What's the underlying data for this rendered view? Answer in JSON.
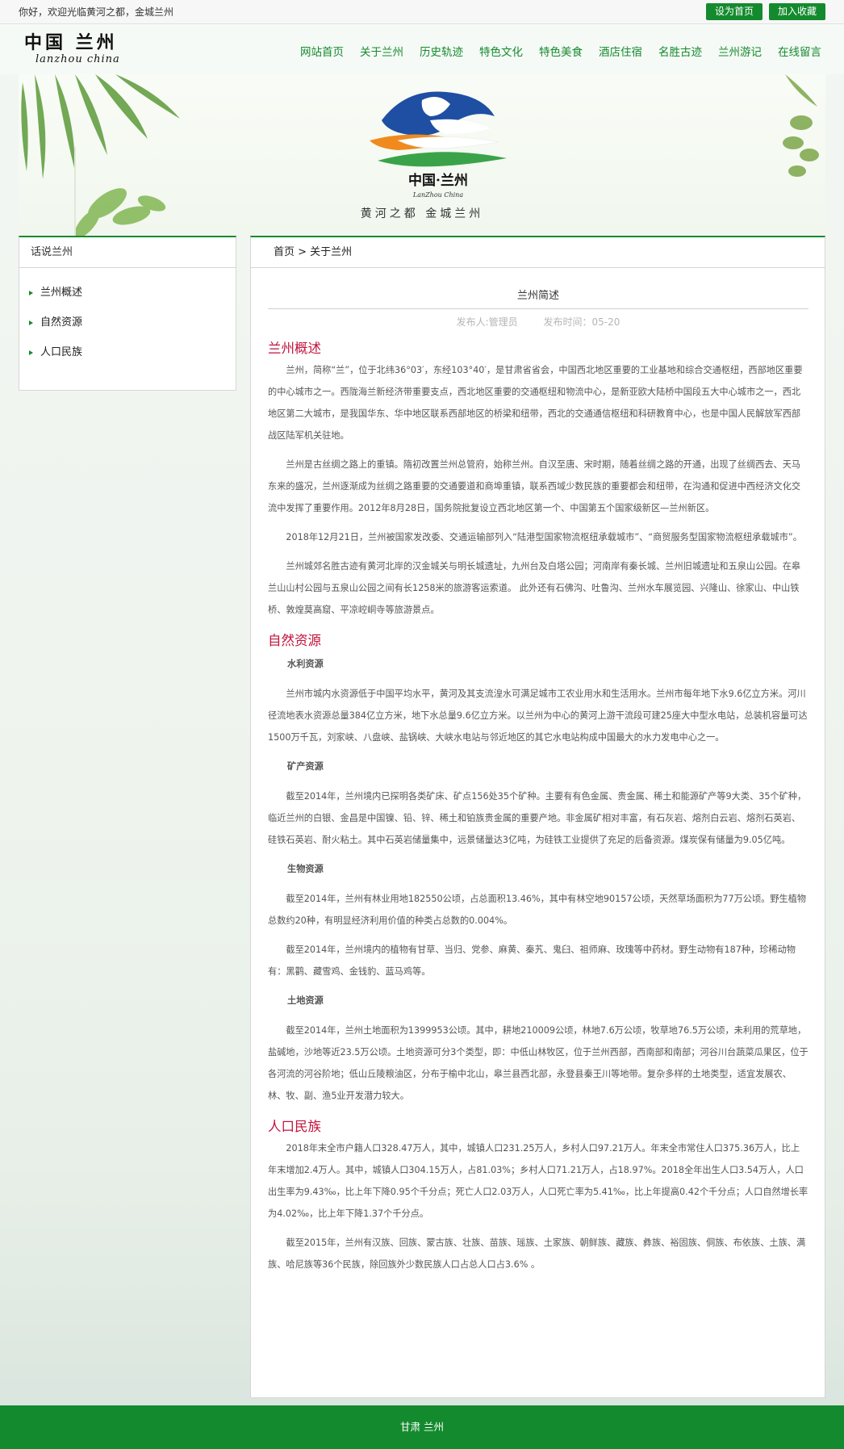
{
  "topbar": {
    "welcome": "你好，欢迎光临黄河之都，金城兰州",
    "set_home": "设为首页",
    "add_fav": "加入收藏"
  },
  "logo": {
    "cn": "中国 兰州",
    "en": "lanzhou  china"
  },
  "nav": [
    "网站首页",
    "关于兰州",
    "历史轨迹",
    "特色文化",
    "特色美食",
    "酒店住宿",
    "名胜古迹",
    "兰州游记",
    "在线留言"
  ],
  "banner": {
    "emblem_text": "中国·兰州",
    "emblem_sub": "LanZhou China",
    "tagline": "黄河之都  金城兰州"
  },
  "sidebar": {
    "title": "话说兰州",
    "items": [
      "兰州概述",
      "自然资源",
      "人口民族"
    ]
  },
  "breadcrumb": "首页 > 关于兰州",
  "article": {
    "title": "兰州简述",
    "author": "发布人:管理员",
    "time": "发布时间：05-20",
    "sections": [
      {
        "heading": "兰州概述",
        "blocks": [
          {
            "type": "p",
            "text": "兰州，简称“兰”，位于北纬36°03′，东经103°40′，是甘肃省省会，中国西北地区重要的工业基地和综合交通枢纽，西部地区重要的中心城市之一。西陇海兰新经济带重要支点，西北地区重要的交通枢纽和物流中心，是新亚欧大陆桥中国段五大中心城市之一，西北地区第二大城市，是我国华东、华中地区联系西部地区的桥梁和纽带，西北的交通通信枢纽和科研教育中心，也是中国人民解放军西部战区陆军机关驻地。"
          },
          {
            "type": "p",
            "text": "兰州是古丝绸之路上的重镇。隋初改置兰州总管府，始称兰州。自汉至唐、宋时期，随着丝绸之路的开通，出现了丝绸西去、天马东来的盛况，兰州逐渐成为丝绸之路重要的交通要道和商埠重镇，联系西域少数民族的重要都会和纽带，在沟通和促进中西经济文化交流中发挥了重要作用。2012年8月28日，国务院批复设立西北地区第一个、中国第五个国家级新区—兰州新区。"
          },
          {
            "type": "p",
            "text": "2018年12月21日，兰州被国家发改委、交通运输部列入“陆港型国家物流枢纽承载城市”、“商贸服务型国家物流枢纽承载城市”。"
          },
          {
            "type": "p",
            "text": "兰州城郊名胜古迹有黄河北岸的汉金城关与明长城遗址，九州台及白塔公园；河南岸有秦长城、兰州旧城遗址和五泉山公园。在皋兰山山村公园与五泉山公园之间有长1258米的旅游客运索道。 此外还有石佛沟、吐鲁沟、兰州水车展览园、兴隆山、徐家山、中山铁桥、敦煌莫高窟、平凉崆峒寺等旅游景点。"
          }
        ]
      },
      {
        "heading": "自然资源",
        "blocks": [
          {
            "type": "h",
            "text": "水利资源"
          },
          {
            "type": "p",
            "text": "兰州市城内水资源低于中国平均水平，黄河及其支流湟水可满足城市工农业用水和生活用水。兰州市每年地下水9.6亿立方米。河川径流地表水资源总量384亿立方米，地下水总量9.6亿立方米。以兰州为中心的黄河上游干流段可建25座大中型水电站，总装机容量可达1500万千瓦，刘家峡、八盘峡、盐锅峡、大峡水电站与邻近地区的其它水电站构成中国最大的水力发电中心之一。"
          },
          {
            "type": "h",
            "text": "矿产资源"
          },
          {
            "type": "p",
            "text": "截至2014年，兰州境内已探明各类矿床、矿点156处35个矿种。主要有有色金属、贵金属、稀土和能源矿产等9大类、35个矿种，临近兰州的白银、金昌是中国镍、铅、锌、稀土和铂族贵金属的重要产地。非金属矿相对丰富，有石灰岩、熔剂白云岩、熔剂石英岩、硅铁石英岩、耐火粘土。其中石英岩储量集中，远景储量达3亿吨，为硅铁工业提供了充足的后备资源。煤炭保有储量为9.05亿吨。"
          },
          {
            "type": "h",
            "text": "生物资源"
          },
          {
            "type": "p",
            "text": "截至2014年，兰州有林业用地182550公顷，占总面积13.46%，其中有林空地90157公顷，天然草场面积为77万公顷。野生植物总数约20种，有明显经济利用价值的种类占总数的0.004%。"
          },
          {
            "type": "p",
            "text": "截至2014年，兰州境内的植物有甘草、当归、党参、麻黄、秦艽、鬼臼、祖师麻、玫瑰等中药材。野生动物有187种，珍稀动物有：黑鹳、藏雪鸡、金钱豹、蓝马鸡等。"
          },
          {
            "type": "h",
            "text": "土地资源"
          },
          {
            "type": "p",
            "text": "截至2014年，兰州土地面积为1399953公顷。其中，耕地210009公顷，林地7.6万公顷，牧草地76.5万公顷，未利用的荒草地，盐碱地，沙地等近23.5万公顷。土地资源可分3个类型，即：中低山林牧区，位于兰州西部，西南部和南部；河谷川台蔬菜瓜果区，位于各河流的河谷阶地；低山丘陵粮油区，分布于榆中北山，皋兰县西北部，永登县秦王川等地带。复杂多样的土地类型，适宜发展农、林、牧、副、渔5业开发潜力较大。"
          }
        ]
      },
      {
        "heading": "人口民族",
        "blocks": [
          {
            "type": "p",
            "text": "2018年末全市户籍人口328.47万人，其中，城镇人口231.25万人，乡村人口97.21万人。年末全市常住人口375.36万人，比上年末增加2.4万人。其中，城镇人口304.15万人，占81.03%；乡村人口71.21万人，占18.97%。2018全年出生人口3.54万人，人口出生率为9.43‰，比上年下降0.95个千分点；死亡人口2.03万人，人口死亡率为5.41‰，比上年提高0.42个千分点；人口自然增长率为4.02‰，比上年下降1.37个千分点。"
          },
          {
            "type": "p",
            "text": "截至2015年，兰州有汉族、回族、蒙古族、壮族、苗族、瑶族、土家族、朝鲜族、藏族、彝族、裕固族、侗族、布依族、土族、满族、哈尼族等36个民族，除回族外少数民族人口占总人口占3.6% 。"
          }
        ]
      }
    ]
  },
  "footer": "甘肃 兰州",
  "colors": {
    "accent": "#148a2e",
    "heading": "#c1123b"
  }
}
